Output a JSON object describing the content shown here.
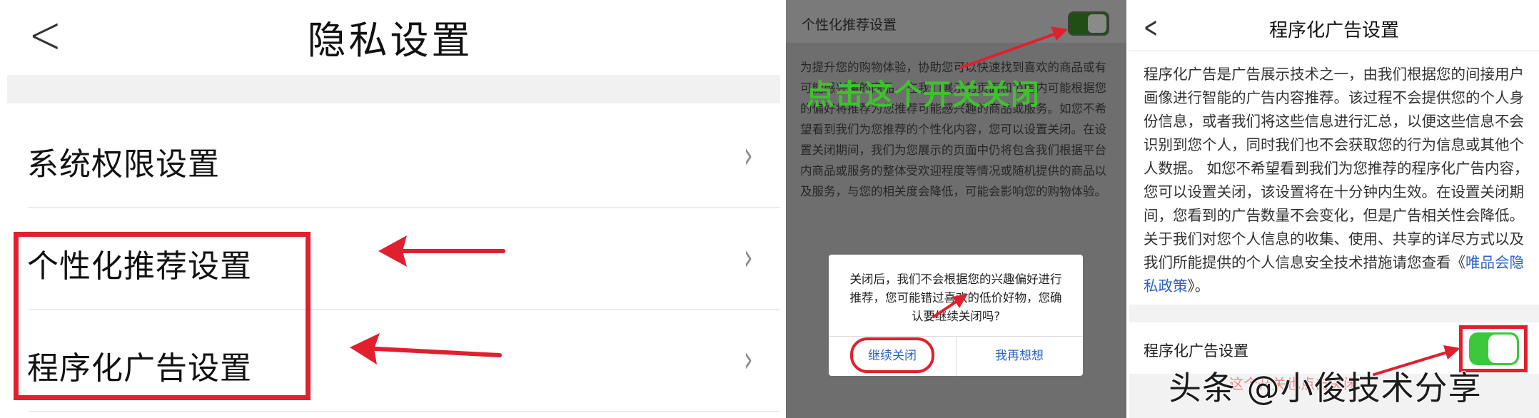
{
  "panel1": {
    "title": "隐私设置",
    "back_icon": "chevron-left-icon",
    "rows": [
      {
        "label": "系统权限设置"
      },
      {
        "label": "个性化推荐设置"
      },
      {
        "label": "程序化广告设置"
      }
    ],
    "chevron": "›"
  },
  "panel2": {
    "header": "个性化推荐设置",
    "description": "为提升您的购物体验，协助您可以快速找到喜欢的商品或有可能感兴趣的商品，在我们展示的页面和范围内可能根据您的偏好将推荐为您推荐可能感兴趣的商品或服务。如您不希望看到我们为您推荐的个性化内容，您可以设置关闭。在设置关闭期间，我们为您展示的页面中仍将包含我们根据平台内商品或服务的整体受欢迎程度等情况或随机提供的商品以及服务，与您的相关度会降低，可能会影响您的购物体验。",
    "overlay_text": "点击这个开关关闭",
    "dialog": {
      "message": "关闭后，我们不会根据您的兴趣偏好进行推荐，您可能错过喜欢的低价好物，您确认要继续关闭吗?",
      "confirm": "继续关闭",
      "cancel": "我再想想"
    }
  },
  "panel3": {
    "title": "程序化广告设置",
    "para_main": "程序化广告是广告展示技术之一，由我们根据您的间接用户画像进行智能的广告内容推荐。该过程不会提供您的个人身份信息，或者我们将这些信息进行汇总，以便这些信息不会识别到您个人，同时我们也不会获取您的行为信息或其他个人数据。 如您不希望看到我们为您推荐的程序化广告内容，您可以设置关闭，该设置将在十分钟内生效。在设置关闭期间，您看到的广告数量不会变化，但是广告相关性会降低。 关于我们对您个人信息的收集、使用、共享的详尽方式以及我们所能提供的个人信息安全技术措施请您查看《",
    "para_link": "唯品会隐私政策",
    "para_end": "》。",
    "setting_label": "程序化广告设置",
    "faint_text": "这个开关也点击关闭"
  },
  "watermark": "头条 @小俊技术分享",
  "colors": {
    "annotation_red": "#e0202e",
    "toggle_green": "#3cc83c",
    "overlay_green": "#3fc22e",
    "link_blue": "#2b63c7"
  }
}
